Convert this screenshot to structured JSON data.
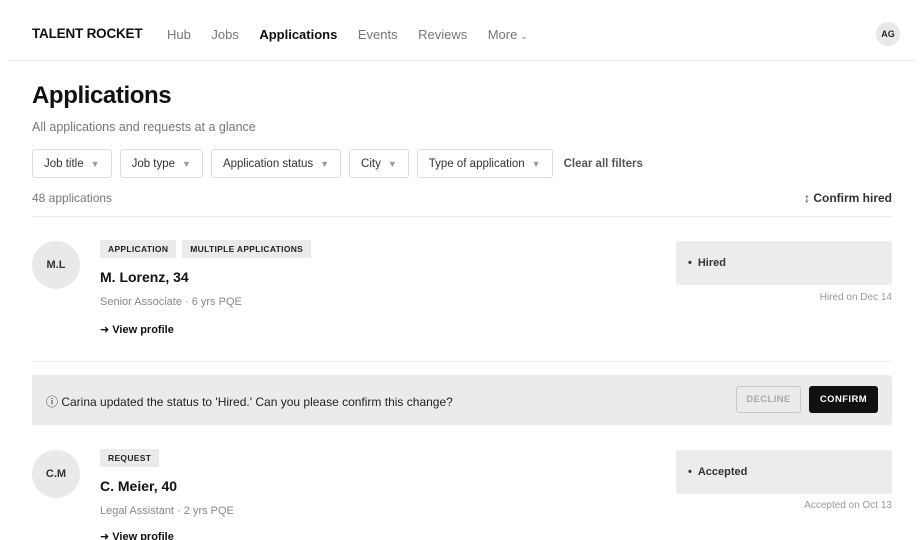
{
  "app": {
    "logo": "TALENT ROCKET",
    "nav": [
      {
        "label": "Hub"
      },
      {
        "label": "Jobs"
      },
      {
        "label": "Applications",
        "active": true
      },
      {
        "label": "Events"
      },
      {
        "label": "Reviews"
      },
      {
        "label": "More",
        "chevron": "⌄"
      }
    ],
    "user_initials": "AG"
  },
  "page": {
    "title": "Applications",
    "subtitle": "All applications and requests at a glance"
  },
  "filters": {
    "items": [
      {
        "label": "Job title",
        "caret": "▼"
      },
      {
        "label": "Job type",
        "caret": "▼"
      },
      {
        "label": "Application status",
        "caret": "▼"
      },
      {
        "label": "City",
        "caret": "▼"
      },
      {
        "label": "Type of application",
        "caret": "▼"
      }
    ],
    "clear_label": "Clear all filters"
  },
  "list": {
    "count": "48 applications",
    "sort_label": "↕ Confirm hired"
  },
  "applications": [
    {
      "initials": "M.L",
      "tags": [
        "APPLICATION",
        "MULTIPLE APPLICATIONS"
      ],
      "name": "M. Lorenz, 34",
      "meta": "Senior Associate · 6 yrs PQE",
      "profile_link": "➜ View profile",
      "status_bullet": "•",
      "status": "Hired",
      "status_date": "Hired on Dec 14"
    },
    {
      "initials": "C.M",
      "tags": [
        "REQUEST"
      ],
      "name": "C. Meier, 40",
      "meta": "Legal Assistant · 2 yrs PQE",
      "profile_link": "➜ View profile",
      "status_bullet": "•",
      "status": "Accepted",
      "status_date": "Accepted on Oct 13"
    }
  ],
  "banner": {
    "text": "ⓘ Carina updated the status to 'Hired.' Can you please confirm this change?",
    "decline_label": "DECLINE",
    "confirm_label": "CONFIRM"
  }
}
